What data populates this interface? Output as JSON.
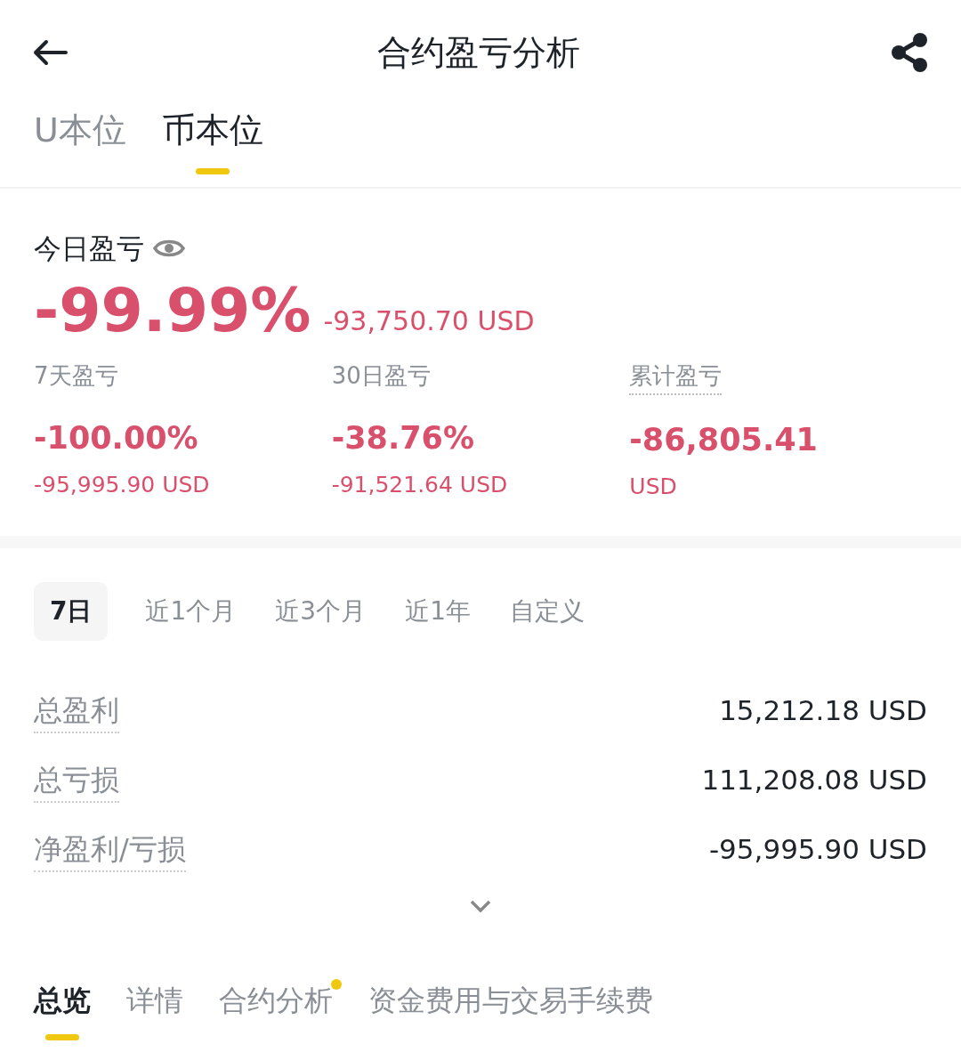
{
  "header": {
    "title": "合约盈亏分析"
  },
  "currency_tabs": [
    {
      "label": "U本位",
      "selected": false
    },
    {
      "label": "币本位",
      "selected": true
    }
  ],
  "today": {
    "label": "今日盈亏",
    "percent": "-99.99%",
    "amount": "-93,750.70 USD"
  },
  "stats": [
    {
      "label": "7天盈亏",
      "dotted": false,
      "value": "-100.00%",
      "sub": "-95,995.90 USD"
    },
    {
      "label": "30日盈亏",
      "dotted": false,
      "value": "-38.76%",
      "sub": "-91,521.64 USD"
    },
    {
      "label": "累计盈亏",
      "dotted": true,
      "value": "-86,805.41",
      "sub": "USD"
    }
  ],
  "periods": [
    {
      "label": "7日",
      "selected": true
    },
    {
      "label": "近1个月",
      "selected": false
    },
    {
      "label": "近3个月",
      "selected": false
    },
    {
      "label": "近1年",
      "selected": false
    },
    {
      "label": "自定义",
      "selected": false
    }
  ],
  "summary": [
    {
      "label": "总盈利",
      "value": "15,212.18 USD"
    },
    {
      "label": "总亏损",
      "value": "111,208.08 USD"
    },
    {
      "label": "净盈利/亏损",
      "value": "-95,995.90 USD"
    }
  ],
  "bottom_tabs": [
    {
      "label": "总览",
      "selected": true,
      "dot": false
    },
    {
      "label": "详情",
      "selected": false,
      "dot": false
    },
    {
      "label": "合约分析",
      "selected": false,
      "dot": true
    },
    {
      "label": "资金费用与交易手续费",
      "selected": false,
      "dot": false
    }
  ]
}
